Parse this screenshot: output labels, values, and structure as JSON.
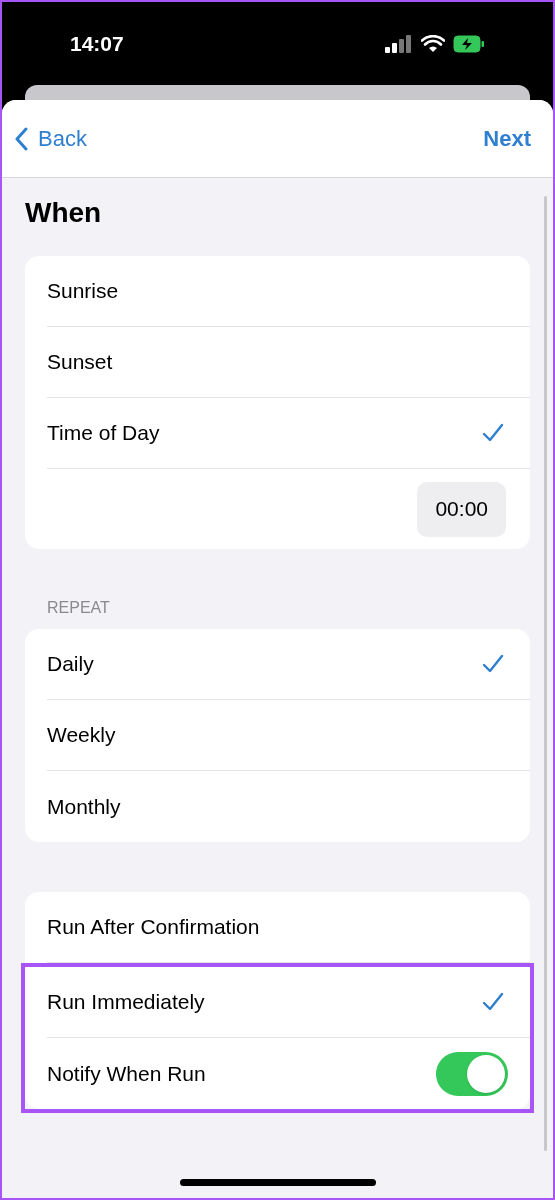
{
  "status_bar": {
    "time": "14:07"
  },
  "nav": {
    "back": "Back",
    "next": "Next"
  },
  "title": "When",
  "time_options": [
    {
      "label": "Sunrise",
      "selected": false
    },
    {
      "label": "Sunset",
      "selected": false
    },
    {
      "label": "Time of Day",
      "selected": true
    }
  ],
  "time_value": "00:00",
  "repeat": {
    "header": "REPEAT",
    "options": [
      {
        "label": "Daily",
        "selected": true
      },
      {
        "label": "Weekly",
        "selected": false
      },
      {
        "label": "Monthly",
        "selected": false
      }
    ]
  },
  "run_options": [
    {
      "kind": "choice",
      "label": "Run After Confirmation",
      "selected": false,
      "highlighted": false
    },
    {
      "kind": "choice",
      "label": "Run Immediately",
      "selected": true,
      "highlighted": true
    },
    {
      "kind": "toggle",
      "label": "Notify When Run",
      "on": true,
      "highlighted": true
    }
  ]
}
